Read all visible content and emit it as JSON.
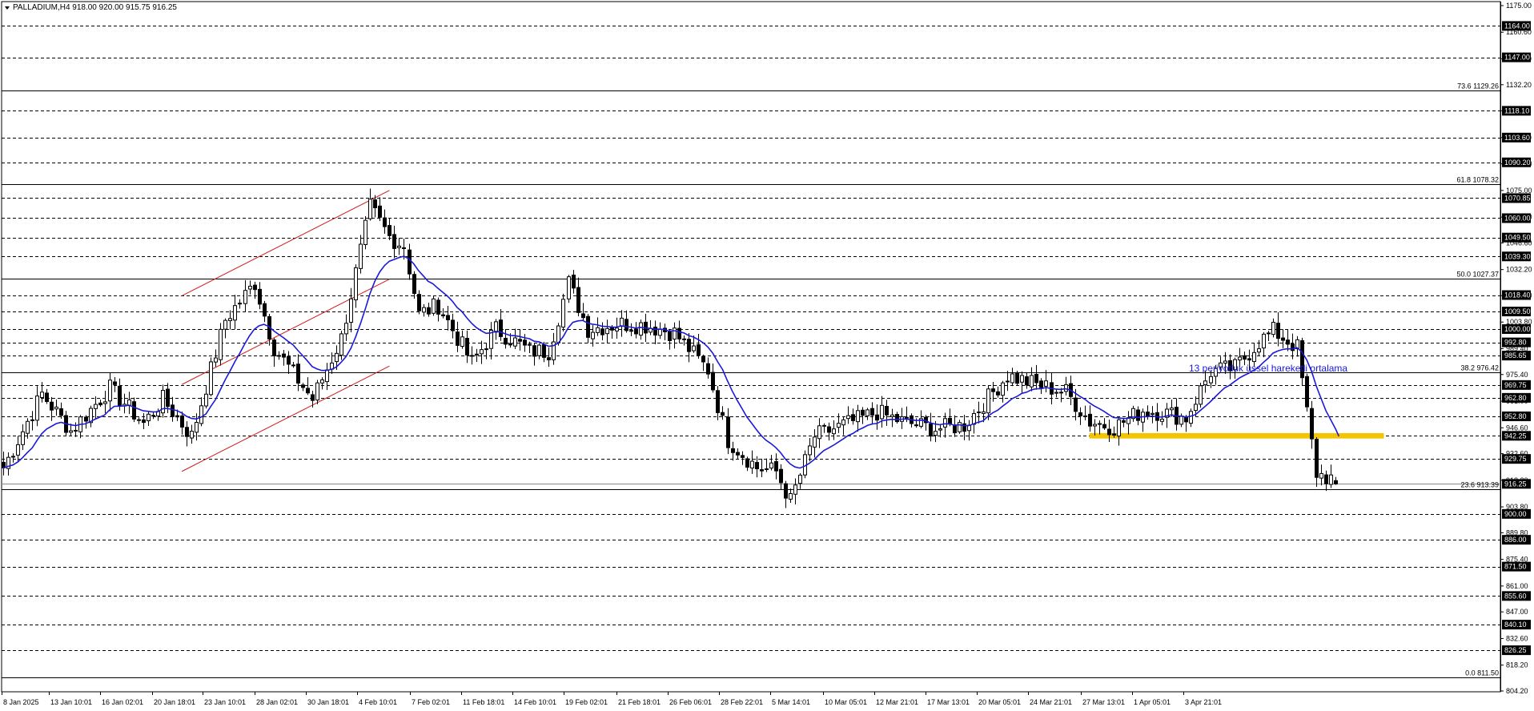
{
  "colors": {
    "background": "#ffffff",
    "candle": "#000000",
    "ema": "#1a1adb",
    "channel": "#d11b1b",
    "zone": "#f5c400",
    "level": "#000000",
    "tag_bg": "#000000",
    "tag_text": "#ffffff",
    "note": "#1a1adb"
  },
  "chart_data": {
    "type": "candlestick",
    "symbol": "PALLADIUM,H4",
    "ohlc_header": "918.00 920.00 915.75 916.25",
    "title": "PALLADIUM,H4  918.00 920.00 915.75 916.25",
    "y_range": [
      804.2,
      1175.0
    ],
    "grid": false,
    "y_ticks": [
      "1175.00",
      "1160.60",
      "1146.20",
      "1132.20",
      "1118.10",
      "1103.60",
      "1089.40",
      "1075.00",
      "1060.60",
      "1046.60",
      "1032.20",
      "1018.10",
      "1003.80",
      "989.40",
      "975.40",
      "961.00",
      "946.60",
      "932.60",
      "918.20",
      "903.80",
      "889.80",
      "875.40",
      "861.00",
      "847.00",
      "832.60",
      "818.20",
      "804.20"
    ],
    "x_labels": [
      "8 Jan 2025",
      "13 Jan 10:01",
      "16 Jan 02:01",
      "20 Jan 18:01",
      "23 Jan 10:01",
      "28 Jan 02:01",
      "30 Jan 18:01",
      "4 Feb 10:01",
      "7 Feb 02:01",
      "11 Feb 18:01",
      "14 Feb 10:01",
      "19 Feb 02:01",
      "21 Feb 18:01",
      "26 Feb 06:01",
      "28 Feb 22:01",
      "5 Mar 14:01",
      "10 Mar 05:01",
      "12 Mar 21:01",
      "17 Mar 13:01",
      "20 Mar 05:01",
      "24 Mar 21:01",
      "27 Mar 13:01",
      "1 Apr 05:01",
      "3 Apr 21:01"
    ],
    "dashed_levels": [
      {
        "value": 1164.0,
        "label": "1164.00"
      },
      {
        "value": 1147.0,
        "label": "1147.00"
      },
      {
        "value": 1118.1,
        "label": "1118.10"
      },
      {
        "value": 1103.6,
        "label": "1103.60"
      },
      {
        "value": 1090.2,
        "label": "1090.20"
      },
      {
        "value": 1070.85,
        "label": "1070.85"
      },
      {
        "value": 1060.0,
        "label": "1060.00"
      },
      {
        "value": 1049.5,
        "label": "1049.50"
      },
      {
        "value": 1039.3,
        "label": "1039.30"
      },
      {
        "value": 1018.4,
        "label": "1018.40"
      },
      {
        "value": 1009.5,
        "label": "1009.50"
      },
      {
        "value": 1000.0,
        "label": "1000.00"
      },
      {
        "value": 992.8,
        "label": "992.80"
      },
      {
        "value": 985.65,
        "label": "985.65"
      },
      {
        "value": 969.75,
        "label": "969.75"
      },
      {
        "value": 962.8,
        "label": "962.80"
      },
      {
        "value": 952.8,
        "label": "952.80"
      },
      {
        "value": 942.25,
        "label": "942.25"
      },
      {
        "value": 929.75,
        "label": "929.75"
      },
      {
        "value": 900.0,
        "label": "900.00"
      },
      {
        "value": 886.0,
        "label": "886.00"
      },
      {
        "value": 871.5,
        "label": "871.50"
      },
      {
        "value": 855.6,
        "label": "855.60"
      },
      {
        "value": 840.1,
        "label": "840.10"
      },
      {
        "value": 826.25,
        "label": "826.25"
      }
    ],
    "current_price": {
      "value": 916.25,
      "label": "916.25"
    },
    "fibonacci": [
      {
        "value": 1129.26,
        "label": "73.6 1129.26"
      },
      {
        "value": 1078.32,
        "label": "61.8 1078.32"
      },
      {
        "value": 1027.37,
        "label": "50.0 1027.37"
      },
      {
        "value": 976.42,
        "label": "38.2 976.42"
      },
      {
        "value": 913.39,
        "label": "23.6 913.39"
      },
      {
        "value": 811.5,
        "label": "0.0 811.50"
      }
    ],
    "ema_label": "13 periyotluk üssel hareketli ortalama",
    "support_zone": {
      "from_index": 225,
      "to_index": 286,
      "low": 940.8,
      "high": 943.7
    },
    "channel": {
      "upper": {
        "start_index": 37,
        "start_price": 1018.0,
        "end_index": 80,
        "end_price": 1075.0
      },
      "lower": {
        "start_index": 37,
        "start_price": 923.0,
        "end_index": 80,
        "end_price": 980.0
      }
    },
    "anchors": [
      [
        0,
        925
      ],
      [
        8,
        965
      ],
      [
        14,
        945
      ],
      [
        22,
        968
      ],
      [
        29,
        949
      ],
      [
        33,
        962
      ],
      [
        39,
        942
      ],
      [
        46,
        1005
      ],
      [
        52,
        1025
      ],
      [
        56,
        990
      ],
      [
        64,
        962
      ],
      [
        70,
        995
      ],
      [
        76,
        1066
      ],
      [
        80,
        1050
      ],
      [
        83,
        1045
      ],
      [
        86,
        1008
      ],
      [
        90,
        1013
      ],
      [
        97,
        982
      ],
      [
        102,
        1000
      ],
      [
        109,
        988
      ],
      [
        113,
        988
      ],
      [
        117,
        1025
      ],
      [
        121,
        1000
      ],
      [
        128,
        1003
      ],
      [
        133,
        1002
      ],
      [
        139,
        998
      ],
      [
        146,
        978
      ],
      [
        150,
        940
      ],
      [
        156,
        925
      ],
      [
        160,
        923
      ],
      [
        163,
        907
      ],
      [
        168,
        942
      ],
      [
        176,
        950
      ],
      [
        181,
        955
      ],
      [
        186,
        950
      ],
      [
        193,
        946
      ],
      [
        199,
        948
      ],
      [
        208,
        975
      ],
      [
        214,
        970
      ],
      [
        220,
        966
      ],
      [
        225,
        950
      ],
      [
        230,
        947
      ],
      [
        236,
        956
      ],
      [
        240,
        955
      ],
      [
        245,
        952
      ],
      [
        250,
        977
      ],
      [
        255,
        979
      ],
      [
        260,
        993
      ],
      [
        263,
        999
      ],
      [
        268,
        990
      ],
      [
        270,
        955
      ],
      [
        272,
        922
      ],
      [
        276,
        918
      ]
    ],
    "series": [
      {
        "name": "13 periyotluk üssel hareketli ortalama",
        "type": "ema",
        "period": 13
      }
    ]
  }
}
